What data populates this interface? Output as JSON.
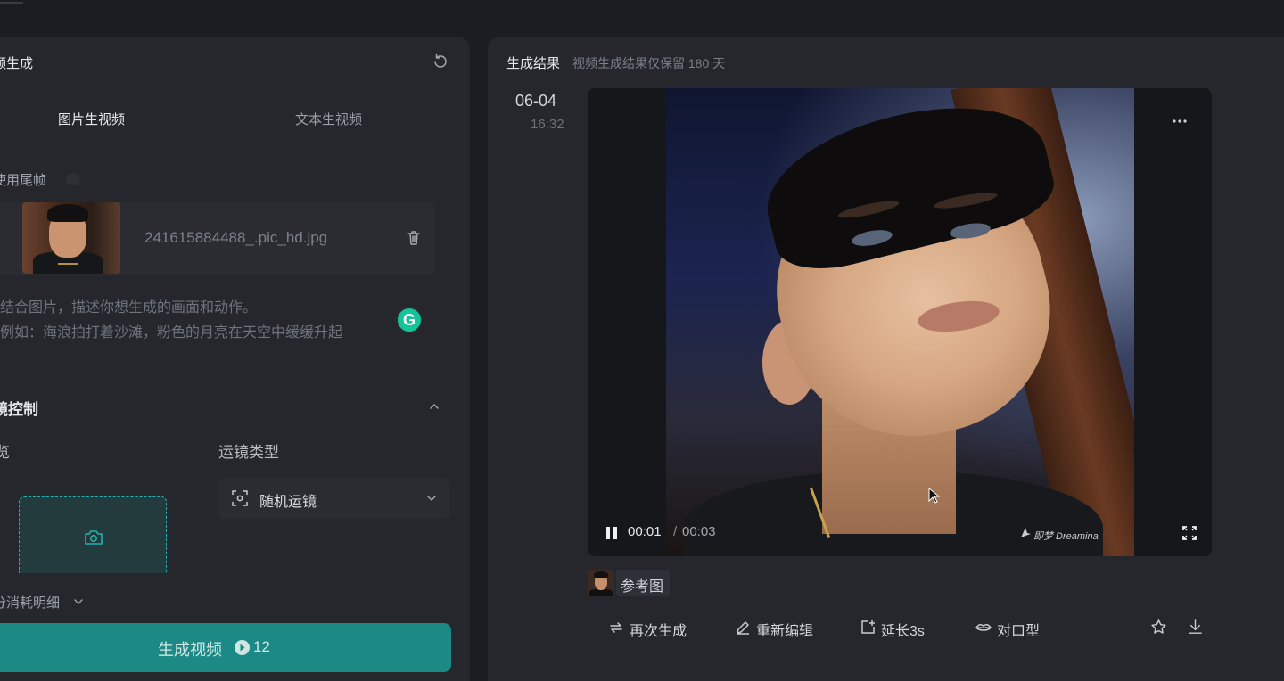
{
  "left_panel": {
    "title": "频生成",
    "tabs": [
      {
        "label": "图片生视频",
        "active": true
      },
      {
        "label": "文本生视频",
        "active": false
      }
    ],
    "end_frame_label": "使用尾帧",
    "uploaded_file": {
      "name": "241615884488_.pic_hd.jpg"
    },
    "prompt_placeholder": {
      "line1": "结合图片，描述你想生成的画面和动作。",
      "line2": "例如：海浪拍打着沙滩，粉色的月亮在天空中缓缓升起"
    },
    "grammarly_letter": "G",
    "camera_control": {
      "title": "镜控制",
      "preview_label": "览",
      "type_label": "运镜类型",
      "type_value": "随机运镜"
    },
    "cost_detail": "分消耗明细",
    "generate_button": {
      "label": "生成视频",
      "cost": "12"
    }
  },
  "right_panel": {
    "title": "生成结果",
    "subtitle": "视频生成结果仅保留 180 天",
    "date": "06-04",
    "time": "16:32",
    "player": {
      "current_time": "00:01",
      "separator": "/",
      "total_time": "00:03",
      "watermark": "即梦 Dreamina",
      "state": "playing"
    },
    "reference_label": "参考图",
    "actions": [
      {
        "label": "再次生成",
        "icon": "regenerate-icon"
      },
      {
        "label": "重新编辑",
        "icon": "pen-icon"
      },
      {
        "label": "延长3s",
        "icon": "extend-icon"
      },
      {
        "label": "对口型",
        "icon": "lips-icon"
      }
    ]
  },
  "colors": {
    "background": "#1c1d22",
    "panel": "#25272d",
    "accent": "#1c8985",
    "dashed_border": "#1fb3b3"
  }
}
